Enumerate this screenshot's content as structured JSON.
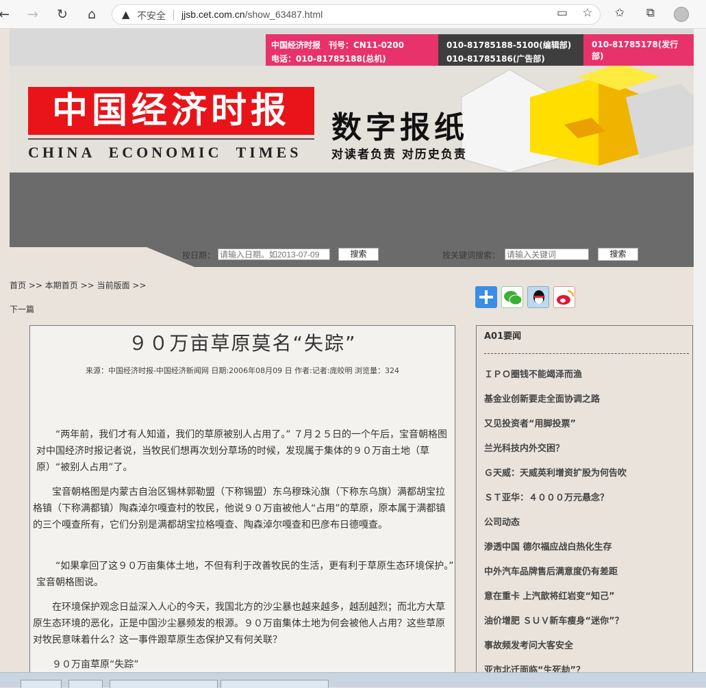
{
  "browser": {
    "insecure_label": "不安全",
    "url_host": "jjsb.cet.com.cn",
    "url_path": "/show_63487.html",
    "icons": [
      "back-icon",
      "forward-icon",
      "reload-icon",
      "home-icon",
      "warning-icon",
      "reader-icon",
      "add-favorite-icon",
      "favorites-icon",
      "collections-icon",
      "profile-icon"
    ]
  },
  "banner": {
    "line1_left": "中国经济时报　刊号：CN11-0200",
    "line2_left": "电话：010-81785188(总机)",
    "line1_mid": "010-81785188-5100(编辑部)",
    "line2_mid": "010-81785186(广告部)",
    "line1_right": "010-81785178(发行部)",
    "logo_cn": "中国经济时报",
    "logo_en": "CHINA ECONOMIC TIMES",
    "digital_title": "数字报纸",
    "slogan": "对读者负责 对历史负责"
  },
  "search": {
    "date_label": "按日期：",
    "date_placeholder": "请输入日期。如2013-07-09",
    "date_button": "搜索",
    "keyword_label": "按关键词搜索：",
    "keyword_placeholder": "请输入关键词",
    "keyword_button": "搜索"
  },
  "breadcrumb": {
    "home": "首页",
    "issue": "本期首页",
    "page": "当前版面",
    "sep": ">>",
    "next": "下一篇"
  },
  "share": {
    "icons": [
      "share-plus-icon",
      "wechat-icon",
      "qq-icon",
      "weibo-icon"
    ]
  },
  "article": {
    "title": "９０万亩草原莫名“失踪”",
    "meta": "来源：中国经济时报-中国经济新闻网  日期:2006年08月09 日 作者:记者:庞皎明  浏览量：324",
    "paragraphs": [
      "“两年前，我们才有人知道，我们的草原被别人占用了。” ７月２５日的一个午后，宝音朝格图对中国经济时报记者说，当牧民们想再次划分草场的时候，发现属于集体的９０万亩土地（草原）“被别人占用”了。",
      "宝音朝格图是内蒙古自治区锡林郭勒盟（下称锡盟）东乌穆珠沁旗（下称东乌旗）满都胡宝拉格镇（下称满都镇）陶森淖尔嘎查村的牧民，他说９０万亩被他人“占用”的草原，原本属于满都镇的三个嘎查所有，它们分别是满都胡宝拉格嘎查、陶森淖尔嘎查和巴彦布日德嘎查。",
      "“如果拿回了这９０万亩集体土地，不但有利于改善牧民的生活，更有利于草原生态环境保护。” 宝音朝格图说。",
      "在环境保护观念日益深入人心的今天，我国北方的沙尘暴也越来越多，越刮越烈；而北方大草原生态环境的恶化，正是中国沙尘暴频发的根源。９０万亩集体土地为何会被他人占用？这些草原对牧民意味着什么？这一事件跟草原生态保护又有何关联？",
      "９０万亩草原“失踪”"
    ]
  },
  "sidebar": {
    "heading": "A01要闻",
    "items": [
      "ＩＰＯ圈钱不能竭泽而渔",
      "基金业创新要走全面协调之路",
      "又见投资者“用脚投票”",
      "兰光科技内外交困？",
      "Ｇ天威：天威英利增资扩股为何告吹",
      "ＳＴ亚华：４０００万元悬念？",
      "公司动态",
      "渗透中国 德尔福应战白热化生存",
      "中外汽车品牌售后满意度仍有差距",
      "意在重卡 上汽歆将红岩变“知己”",
      "油价增肥 ＳＵＶ新车瘦身“迷你”？",
      "事故频发考问大客安全",
      "亚市北迁面临“生死劫”？"
    ]
  },
  "colors": {
    "brand_red": "#e8141a",
    "pink": "#e8326c",
    "gray_band": "#6b6b6b",
    "page_bg": "#e9e3dc"
  }
}
